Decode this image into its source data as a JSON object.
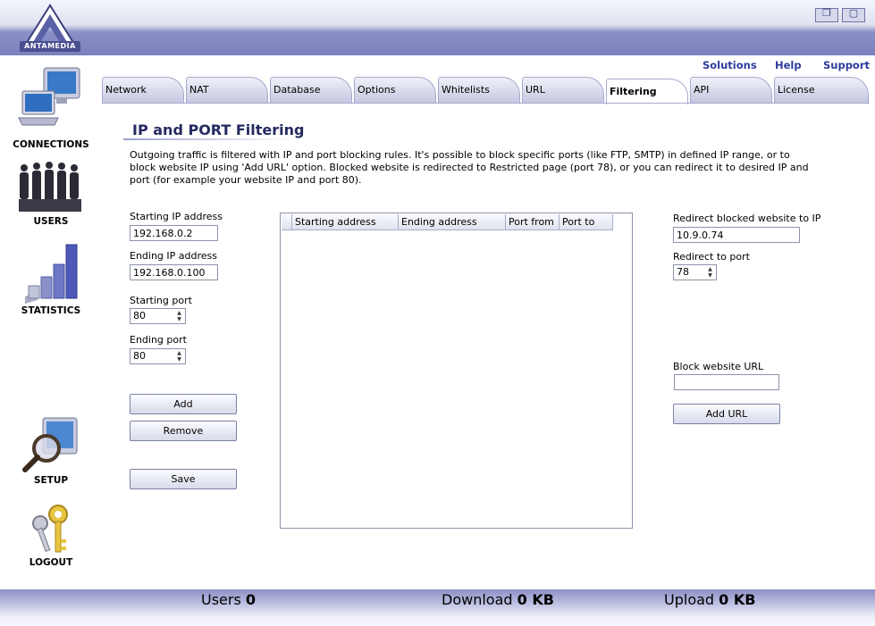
{
  "brand": {
    "logo_text": "ANTAMEDIA"
  },
  "window_controls": {
    "restore_glyph": "❐",
    "close_glyph": "▢"
  },
  "sidebar": {
    "items": [
      {
        "label": "CONNECTIONS",
        "icon": "computer-icon"
      },
      {
        "label": "USERS",
        "icon": "users-icon"
      },
      {
        "label": "STATISTICS",
        "icon": "bar-chart-icon"
      },
      {
        "label": "SETUP",
        "icon": "magnifier-monitor-icon"
      },
      {
        "label": "LOGOUT",
        "icon": "keys-icon"
      }
    ]
  },
  "top_links": {
    "solutions": "Solutions",
    "help": "Help",
    "support": "Support"
  },
  "tabs": [
    {
      "label": "Network"
    },
    {
      "label": "NAT"
    },
    {
      "label": "Database"
    },
    {
      "label": "Options"
    },
    {
      "label": "Whitelists"
    },
    {
      "label": "URL"
    },
    {
      "label": "Filtering",
      "active": true
    },
    {
      "label": "API"
    },
    {
      "label": "License"
    }
  ],
  "content": {
    "title": "IP and PORT Filtering",
    "description": "Outgoing traffic is filtered with IP and port blocking rules. It's possible to block specific ports (like FTP, SMTP) in defined IP range, or to block website IP using 'Add URL' option. Blocked website is redirected to Restricted page (port 78), or you can redirect it to desired IP and port (for example your website IP and port 80)."
  },
  "form": {
    "starting_ip_label": "Starting IP address",
    "starting_ip_value": "192.168.0.2",
    "ending_ip_label": "Ending IP address",
    "ending_ip_value": "192.168.0.100",
    "starting_port_label": "Starting port",
    "starting_port_value": "80",
    "ending_port_label": "Ending port",
    "ending_port_value": "80",
    "add_label": "Add",
    "remove_label": "Remove",
    "save_label": "Save"
  },
  "grid": {
    "columns": [
      "Starting address",
      "Ending address",
      "Port from",
      "Port to"
    ],
    "rows": []
  },
  "redirect": {
    "redirect_ip_label": "Redirect blocked website to IP",
    "redirect_ip_value": "10.9.0.74",
    "redirect_port_label": "Redirect to port",
    "redirect_port_value": "78",
    "block_url_label": "Block website URL",
    "block_url_value": "",
    "add_url_label": "Add URL"
  },
  "footer": {
    "users_label": "Users",
    "users_value": "0",
    "download_label": "Download",
    "download_value": "0 KB",
    "upload_label": "Upload",
    "upload_value": "0 KB"
  },
  "colors": {
    "accent": "#7b80bd",
    "link": "#2c3c9c",
    "title": "#242a5e"
  }
}
